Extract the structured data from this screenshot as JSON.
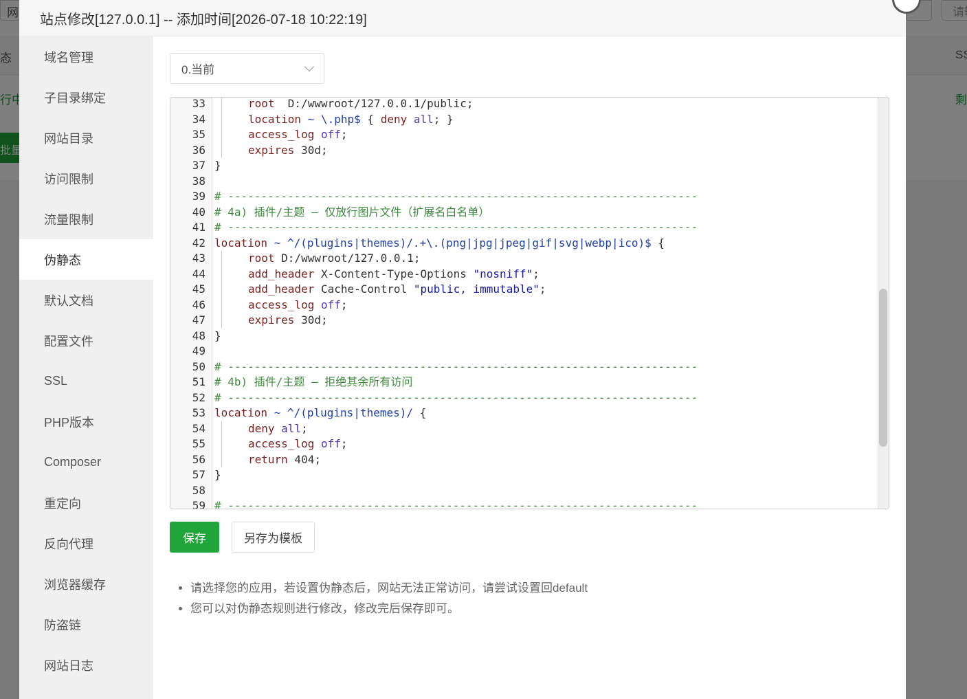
{
  "background": {
    "top_left_text": "网",
    "top_right_text": "请输",
    "row_header_left": "态",
    "row_header_right": "SS",
    "row_left": "行中",
    "row_right": "剩",
    "batch_button": "批量"
  },
  "dialog": {
    "title": "站点修改[127.0.0.1] -- 添加时间[2026-07-18 10:22:19]"
  },
  "sidebar": {
    "items": [
      {
        "label": "域名管理"
      },
      {
        "label": "子目录绑定"
      },
      {
        "label": "网站目录"
      },
      {
        "label": "访问限制"
      },
      {
        "label": "流量限制"
      },
      {
        "label": "伪静态"
      },
      {
        "label": "默认文档"
      },
      {
        "label": "配置文件"
      },
      {
        "label": "SSL"
      },
      {
        "label": "PHP版本"
      },
      {
        "label": "Composer"
      },
      {
        "label": "重定向"
      },
      {
        "label": "反向代理"
      },
      {
        "label": "浏览器缓存"
      },
      {
        "label": "防盗链"
      },
      {
        "label": "网站日志"
      }
    ],
    "active_index": 5
  },
  "rewrite": {
    "selected_version": "0.当前",
    "save_label": "保存",
    "save_template_label": "另存为模板",
    "tips": [
      "请选择您的应用，若设置伪静态后，网站无法正常访问，请尝试设置回default",
      "您可以对伪静态规则进行修改，修改完后保存即可。"
    ]
  },
  "editor": {
    "lines": [
      {
        "n": "33",
        "indent": true,
        "tokens": [
          [
            "kw",
            "root"
          ],
          [
            "",
            "  D:/wwwroot/127.0.0.1/public;"
          ]
        ]
      },
      {
        "n": "34",
        "indent": true,
        "tokens": [
          [
            "kw",
            "location"
          ],
          [
            "",
            " "
          ],
          [
            "blue",
            "~"
          ],
          [
            "",
            " "
          ],
          [
            "blue",
            "\\.php$"
          ],
          [
            "",
            " { "
          ],
          [
            "kw",
            "deny"
          ],
          [
            "",
            " "
          ],
          [
            "vl",
            "all"
          ],
          [
            "",
            "; }"
          ]
        ]
      },
      {
        "n": "35",
        "indent": true,
        "tokens": [
          [
            "kw",
            "access_log"
          ],
          [
            "",
            " "
          ],
          [
            "vl",
            "off"
          ],
          [
            "",
            ";"
          ]
        ]
      },
      {
        "n": "36",
        "indent": true,
        "tokens": [
          [
            "kw",
            "expires"
          ],
          [
            "",
            " 30d;"
          ]
        ]
      },
      {
        "n": "37",
        "indent": false,
        "tokens": [
          [
            "",
            "}"
          ]
        ]
      },
      {
        "n": "38",
        "indent": false,
        "tokens": []
      },
      {
        "n": "39",
        "indent": false,
        "tokens": [
          [
            "cm",
            "# -----------------------------------------------------------------------"
          ]
        ]
      },
      {
        "n": "40",
        "indent": false,
        "tokens": [
          [
            "cm",
            "# 4a) 插件/主题 — 仅放行图片文件（扩展名白名单）"
          ]
        ]
      },
      {
        "n": "41",
        "indent": false,
        "tokens": [
          [
            "cm",
            "# -----------------------------------------------------------------------"
          ]
        ]
      },
      {
        "n": "42",
        "indent": false,
        "tokens": [
          [
            "kw",
            "location"
          ],
          [
            "",
            " "
          ],
          [
            "blue",
            "~"
          ],
          [
            "",
            " "
          ],
          [
            "blue",
            "^/(plugins|themes)/.+\\.(png|jpg|jpeg|gif|svg|webp|ico)$"
          ],
          [
            "",
            " {"
          ]
        ]
      },
      {
        "n": "43",
        "indent": true,
        "tokens": [
          [
            "kw",
            "root"
          ],
          [
            "",
            " D:/wwwroot/127.0.0.1;"
          ]
        ]
      },
      {
        "n": "44",
        "indent": true,
        "tokens": [
          [
            "kw",
            "add_header"
          ],
          [
            "",
            " X-Content-Type-Options "
          ],
          [
            "str",
            "\"nosniff\""
          ],
          [
            "",
            ";"
          ]
        ]
      },
      {
        "n": "45",
        "indent": true,
        "tokens": [
          [
            "kw",
            "add_header"
          ],
          [
            "",
            " Cache-Control "
          ],
          [
            "str",
            "\"public, immutable\""
          ],
          [
            "",
            ";"
          ]
        ]
      },
      {
        "n": "46",
        "indent": true,
        "tokens": [
          [
            "kw",
            "access_log"
          ],
          [
            "",
            " "
          ],
          [
            "vl",
            "off"
          ],
          [
            "",
            ";"
          ]
        ]
      },
      {
        "n": "47",
        "indent": true,
        "tokens": [
          [
            "kw",
            "expires"
          ],
          [
            "",
            " 30d;"
          ]
        ]
      },
      {
        "n": "48",
        "indent": false,
        "tokens": [
          [
            "",
            "}"
          ]
        ]
      },
      {
        "n": "49",
        "indent": false,
        "tokens": []
      },
      {
        "n": "50",
        "indent": false,
        "tokens": [
          [
            "cm",
            "# -----------------------------------------------------------------------"
          ]
        ]
      },
      {
        "n": "51",
        "indent": false,
        "tokens": [
          [
            "cm",
            "# 4b) 插件/主题 — 拒绝其余所有访问"
          ]
        ]
      },
      {
        "n": "52",
        "indent": false,
        "tokens": [
          [
            "cm",
            "# -----------------------------------------------------------------------"
          ]
        ]
      },
      {
        "n": "53",
        "indent": false,
        "tokens": [
          [
            "kw",
            "location"
          ],
          [
            "",
            " "
          ],
          [
            "blue",
            "~"
          ],
          [
            "",
            " "
          ],
          [
            "blue",
            "^/(plugins|themes)/"
          ],
          [
            "",
            " {"
          ]
        ]
      },
      {
        "n": "54",
        "indent": true,
        "tokens": [
          [
            "kw",
            "deny"
          ],
          [
            "",
            " "
          ],
          [
            "vl",
            "all"
          ],
          [
            "",
            ";"
          ]
        ]
      },
      {
        "n": "55",
        "indent": true,
        "tokens": [
          [
            "kw",
            "access_log"
          ],
          [
            "",
            " "
          ],
          [
            "vl",
            "off"
          ],
          [
            "",
            ";"
          ]
        ]
      },
      {
        "n": "56",
        "indent": true,
        "tokens": [
          [
            "kw",
            "return"
          ],
          [
            "",
            " 404;"
          ]
        ]
      },
      {
        "n": "57",
        "indent": false,
        "tokens": [
          [
            "",
            "}"
          ]
        ]
      },
      {
        "n": "58",
        "indent": false,
        "tokens": []
      },
      {
        "n": "59",
        "indent": false,
        "tokens": [
          [
            "cm",
            "# -----------------------------------------------------------------------"
          ]
        ]
      }
    ]
  },
  "colors": {
    "accent": "#20a53a",
    "keyword": "#7a1f1f",
    "comment": "#3f8a3f",
    "string": "#1a1aa6"
  }
}
